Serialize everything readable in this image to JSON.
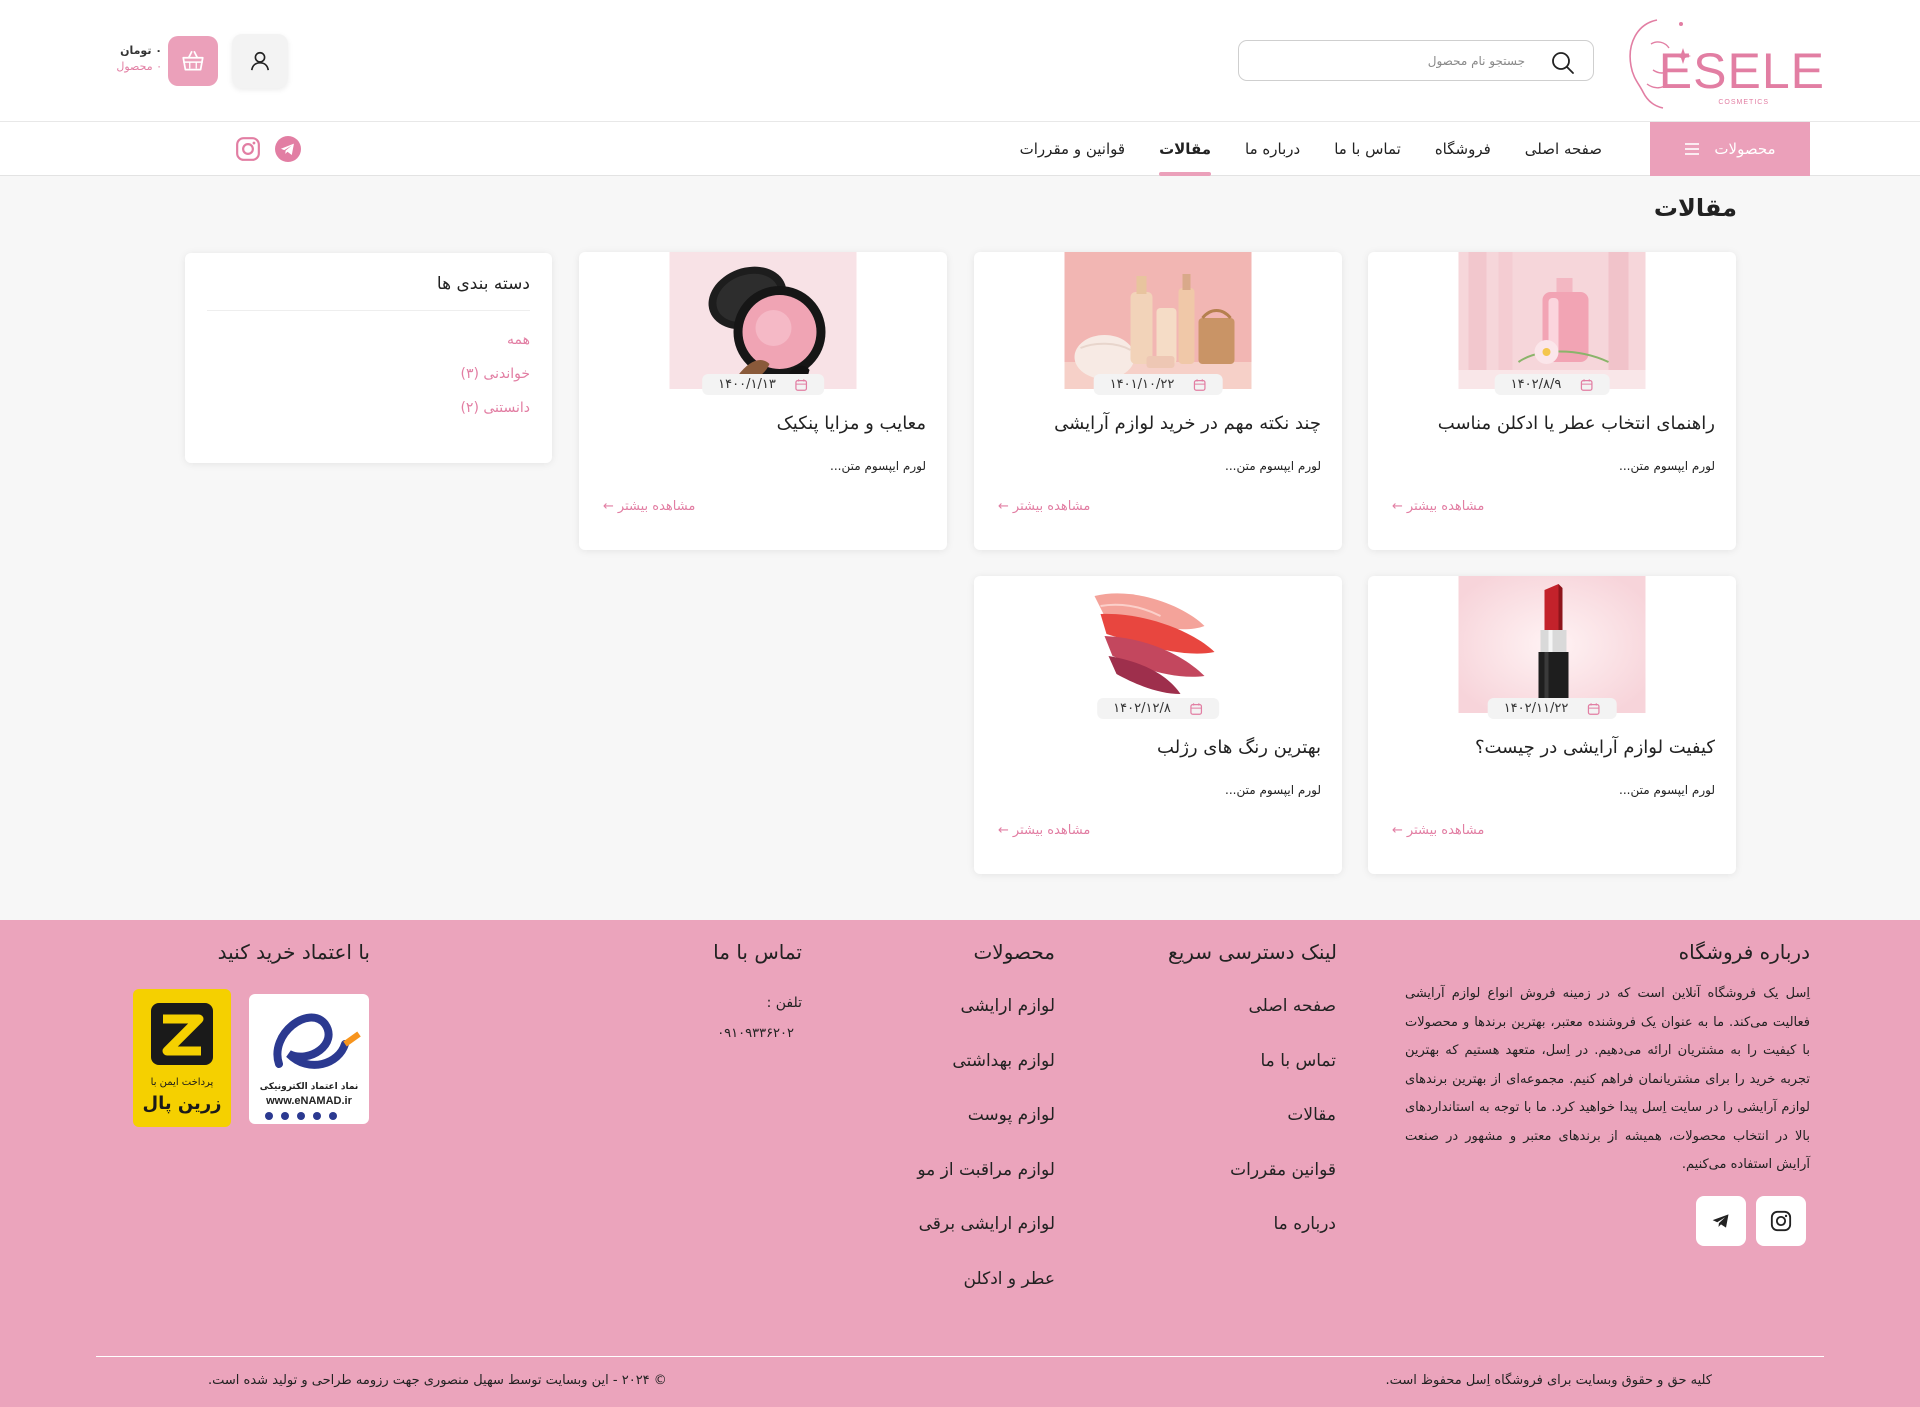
{
  "brand": {
    "name": "ESELE",
    "tagline": "COSMETICS"
  },
  "header": {
    "search_placeholder": "جستجو نام محصول",
    "cart_price": "۰ تومان",
    "cart_count": "۰ محصول"
  },
  "nav": {
    "products_label": "محصولات",
    "links": [
      "صفحه اصلی",
      "فروشگاه",
      "تماس با ما",
      "درباره ما",
      "مقالات",
      "قوانین و مقررات"
    ],
    "active": "مقالات"
  },
  "main": {
    "page_title": "مقالات",
    "articles": [
      {
        "title": "راهنمای انتخاب عطر یا ادکلن مناسب",
        "date": "۱۴۰۲/۸/۹",
        "excerpt": "لورم ایپسوم متن...",
        "more": "مشاهده بیشتر",
        "image": "perfume"
      },
      {
        "title": "چند نکته مهم در خرید لوازم آرایشی",
        "date": "۱۴۰۱/۱۰/۲۲",
        "excerpt": "لورم ایپسوم متن...",
        "more": "مشاهده بیشتر",
        "image": "cosmetics-bottles"
      },
      {
        "title": "معایب و مزایا پنکیک",
        "date": "۱۴۰۰/۱/۱۳",
        "excerpt": "لورم ایپسوم متن...",
        "more": "مشاهده بیشتر",
        "image": "compact-powder"
      },
      {
        "title": "کیفیت لوازم آرایشی در چیست؟",
        "date": "۱۴۰۲/۱۱/۲۲",
        "excerpt": "لورم ایپسوم متن...",
        "more": "مشاهده بیشتر",
        "image": "lipstick"
      },
      {
        "title": "بهترین رنگ های رژلب",
        "date": "۱۴۰۲/۱۲/۸",
        "excerpt": "لورم ایپسوم متن...",
        "more": "مشاهده بیشتر",
        "image": "lipstick-swatches"
      }
    ],
    "sidebar": {
      "title": "دسته بندی ها",
      "categories": [
        "همه",
        "خواندنی (۳)",
        "دانستنی (۲)"
      ]
    }
  },
  "footer": {
    "about_title": "درباره فروشگاه",
    "about_text": "اِسل یک فروشگاه آنلاین است که در زمینه فروش انواع لوازم آرایشی فعالیت می‌کند. ما به عنوان یک فروشنده معتبر، بهترین برندها و محصولات با کیفیت را به مشتریان ارائه می‌دهیم. در اِسل، متعهد هستیم که بهترین تجربه خرید را برای مشتریانمان فراهم کنیم. مجموعه‌ای از بهترین برندهای لوازم آرایشی را در سایت اِسل پیدا خواهید کرد. ما با توجه به استانداردهای بالا در انتخاب محصولات، همیشه از برندهای معتبر و مشهور در صنعت آرایش استفاده می‌کنیم.",
    "quick_links_title": "لینک دسترسی سریع",
    "quick_links": [
      "صفحه اصلی",
      "تماس با ما",
      "مقالات",
      "قوانین مقررات",
      "درباره ما"
    ],
    "products_title": "محصولات",
    "products": [
      "لوازم ارایشی",
      "لوازم بهداشتی",
      "لوازم پوست",
      "لوازم مراقبت از مو",
      "لوازم ارایشی برقی",
      "عطر و ادکلن"
    ],
    "contact_title": "تماس با ما",
    "phone_label": "تلفن :",
    "phone": "۰۹۱۰۹۳۳۶۲۰۲",
    "trust_title": "با اعتماد خرید کنید",
    "enamad_caption": "نماد اعتماد الکترونیکی",
    "enamad_url": "www.eNAMAD.ir",
    "zarinpal_caption": "پرداخت ایمن با",
    "zarinpal_name": "زرین پال",
    "copyright_right": "کلیه حق و حقوق وبسایت برای فروشگاه اِسل محفوظ است.",
    "copyright_left": "© ۲۰۲۴ - این وبسایت توسط سهیل منصوری جهت رزومه طراحی و تولید شده است."
  },
  "colors": {
    "accent": "#eba0ba",
    "accent_text": "#e27ea3",
    "footer_bg": "#eba4bc"
  }
}
